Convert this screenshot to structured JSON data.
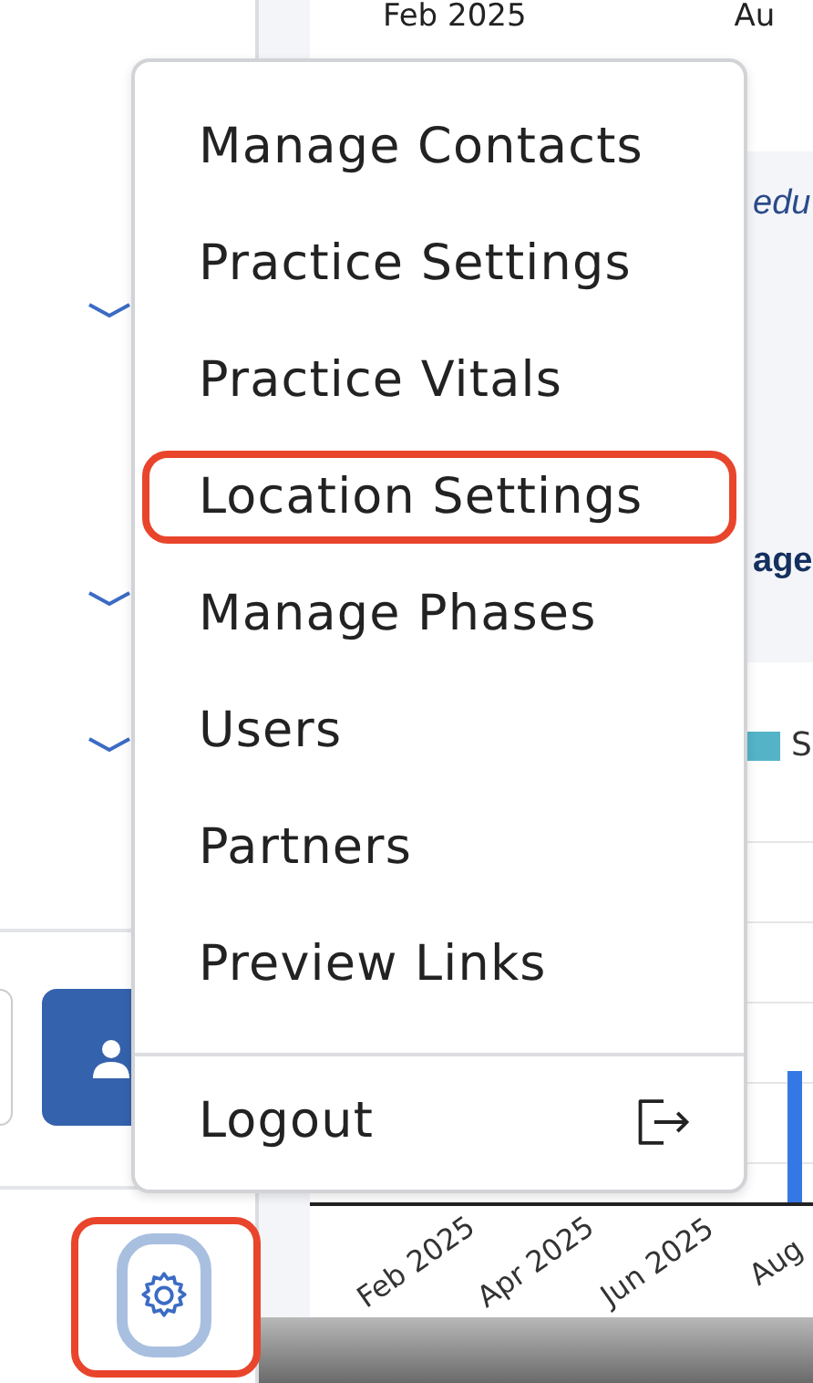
{
  "chart_top_labels": [
    "Feb 2025",
    "Au"
  ],
  "section_heading": "edu",
  "panel_title": "age",
  "legend": [
    {
      "label": "S",
      "color": "#55b3c8"
    }
  ],
  "chart_axis_labels": [
    "Feb 2025",
    "Apr 2025",
    "Jun 2025",
    "Aug"
  ],
  "settings_button": {
    "highlighted": true,
    "selected": true
  },
  "menu": {
    "items": [
      {
        "label": "Manage Contacts",
        "highlighted": false
      },
      {
        "label": "Practice Settings",
        "highlighted": false
      },
      {
        "label": "Practice Vitals",
        "highlighted": false
      },
      {
        "label": "Location Settings",
        "highlighted": true
      },
      {
        "label": "Manage Phases",
        "highlighted": false
      },
      {
        "label": "Users",
        "highlighted": false
      },
      {
        "label": "Partners",
        "highlighted": false
      },
      {
        "label": "Preview Links",
        "highlighted": false
      }
    ],
    "logout": "Logout"
  }
}
